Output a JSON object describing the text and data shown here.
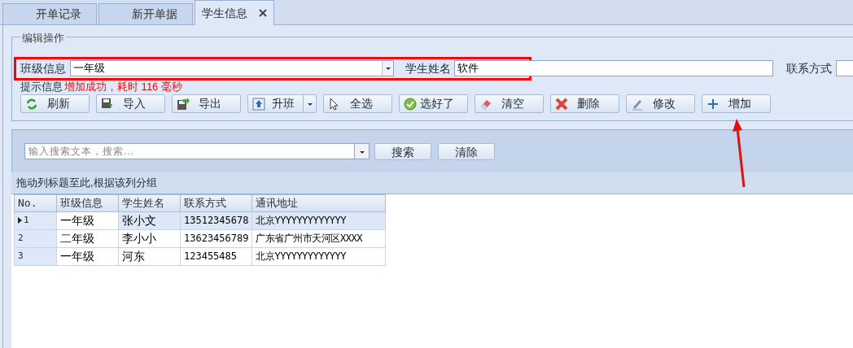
{
  "tabs": [
    {
      "label": "开单记录",
      "selected": false
    },
    {
      "label": "新开单据",
      "selected": false
    },
    {
      "label": "学生信息",
      "selected": true
    }
  ],
  "edit_group": {
    "title": "编辑操作",
    "fields": [
      {
        "label": "班级信息",
        "value": "一年级",
        "kind": "combo"
      },
      {
        "label": "学生姓名",
        "value": "软件",
        "kind": "text"
      },
      {
        "label": "联系方式",
        "kind": "text"
      }
    ],
    "prompt": {
      "label": "提示信息",
      "message": "增加成功，耗时 116 毫秒"
    },
    "buttons": [
      {
        "label": "刷新",
        "kind": "plain"
      },
      {
        "label": "导入",
        "kind": "plain"
      },
      {
        "label": "导出",
        "kind": "plain"
      },
      {
        "label": "升班",
        "kind": "split"
      },
      {
        "label": "全选",
        "kind": "plain"
      },
      {
        "label": "选好了",
        "kind": "plain"
      },
      {
        "label": "清空",
        "kind": "plain"
      },
      {
        "label": "删除",
        "kind": "plain"
      },
      {
        "label": "修改",
        "kind": "plain"
      },
      {
        "label": "增加",
        "kind": "plain"
      }
    ]
  },
  "search": {
    "placeholder": "输入搜索文本，搜索...",
    "buttons": [
      "搜索",
      "清除"
    ]
  },
  "group_hint": "拖动列标题至此,根据该列分组",
  "table": {
    "columns": [
      "No.",
      "班级信息",
      "学生姓名",
      "联系方式",
      "通讯地址"
    ],
    "rows": [
      {
        "cells": [
          "1",
          "一年级",
          "张小文",
          "13512345678",
          "北京YYYYYYYYYYYYY"
        ],
        "selected": true
      },
      {
        "cells": [
          "2",
          "二年级",
          "李小小",
          "13623456789",
          "广东省广州市天河区XXXX"
        ],
        "selected": false
      },
      {
        "cells": [
          "3",
          "一年级",
          "河东",
          "123455485",
          "北京YYYYYYYYYYYYY"
        ],
        "selected": false
      }
    ]
  }
}
